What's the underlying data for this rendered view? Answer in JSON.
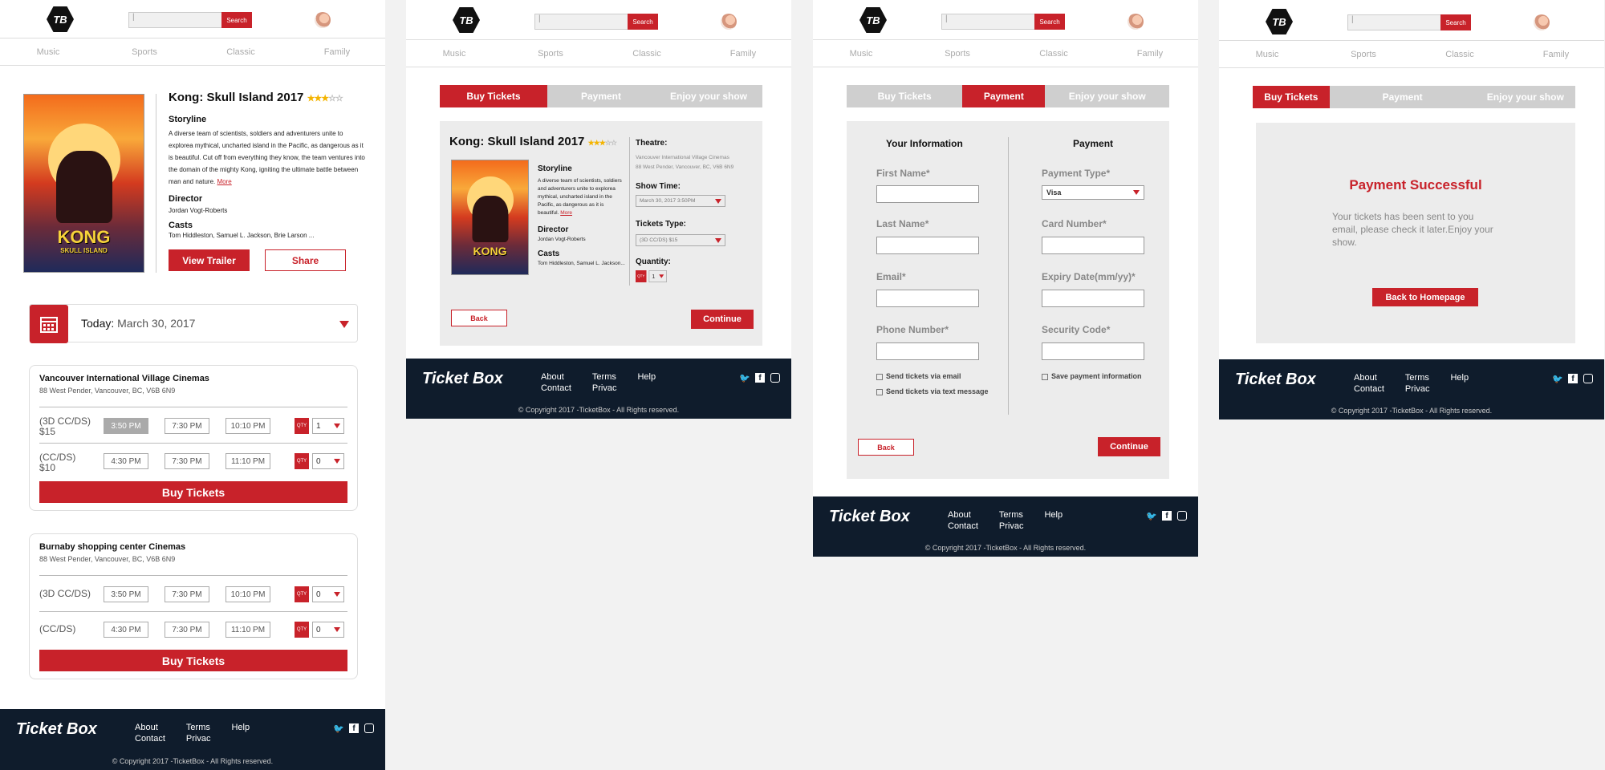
{
  "common": {
    "logo_text": "TB",
    "search_label": "Search",
    "nav": [
      "Music",
      "Sports",
      "Classic",
      "Family"
    ],
    "footer": {
      "brand": "Ticket Box",
      "about": "About",
      "contact": "Contact",
      "terms": "Terms",
      "privacy": "Privac",
      "help": "Help",
      "copyright": "© Copyright 2017 -TicketBox - All Rights reserved.",
      "social_icons": [
        "twitter-icon",
        "facebook-icon",
        "instagram-icon"
      ]
    },
    "accent_color": "#c8222a",
    "footer_color": "#0f1c2c"
  },
  "movie": {
    "title": "Kong: Skull Island 2017",
    "rating": 3,
    "rating_max": 5,
    "poster_title": "KONG",
    "poster_subtitle": "SKULL ISLAND",
    "storyline_label": "Storyline",
    "storyline": "A diverse team of scientists, soldiers and adventurers unite to explorea mythical, uncharted island in the Pacific, as dangerous as it is beautiful. Cut off from everything they know, the team ventures into the domain of the mighty Kong, igniting the ultimate battle between man and nature.",
    "storyline_short": "A diverse team of scientists, soldiers and adventurers unite to explorea mythical, uncharted island in the Pacific, as dangerous as it is beautiful.",
    "more": "More",
    "director_label": "Director",
    "director": "Jordan Vogt-Roberts",
    "casts_label": "Casts",
    "casts": "Tom Hiddleston, Samuel L. Jackson, Brie Larson ...",
    "casts_short": "Tom Hiddleston, Samuel L. Jackson...",
    "view_trailer": "View Trailer",
    "share": "Share"
  },
  "date_bar": {
    "prefix": "Today:",
    "date": "March 30, 2017"
  },
  "theatres": [
    {
      "name": "Vancouver International Village Cinemas",
      "address": "88 West Pender, Vancouver, BC, V6B 6N9",
      "rows": [
        {
          "type": "(3D CC/DS)\n$15",
          "times": [
            "3:50 PM",
            "7:30 PM",
            "10:10 PM"
          ],
          "qty": "1"
        },
        {
          "type": "(CC/DS)\n$10",
          "times": [
            "4:30 PM",
            "7:30 PM",
            "11:10 PM"
          ],
          "qty": "0"
        }
      ],
      "buy": "Buy Tickets"
    },
    {
      "name": "Burnaby shopping center Cinemas",
      "address": "88 West Pender, Vancouver, BC, V6B 6N9",
      "rows": [
        {
          "type": "(3D CC/DS)",
          "times": [
            "3:50 PM",
            "7:30 PM",
            "10:10 PM"
          ],
          "qty": "0"
        },
        {
          "type": "(CC/DS)",
          "times": [
            "4:30 PM",
            "7:30 PM",
            "11:10 PM"
          ],
          "qty": "0"
        }
      ],
      "buy": "Buy Tickets"
    }
  ],
  "qty_label": "QTY",
  "steps": [
    "Buy Tickets",
    "Payment",
    "Enjoy your show"
  ],
  "checkout": {
    "theatre_label": "Theatre:",
    "theatre": "Vancouver International Village Cinemas",
    "address": "88 West Pender, Vancouver, BC, V6B 6N9",
    "showtime_label": "Show Time:",
    "showtime": "March 30, 2017  3:50PM",
    "type_label": "Tickets Type:",
    "type": "(3D CC/DS)  $15",
    "quantity_label": "Quantity:",
    "quantity": "1",
    "back": "Back",
    "continue": "Continue"
  },
  "payment": {
    "info_heading": "Your Information",
    "pay_heading": "Payment",
    "first_name": "First Name*",
    "last_name": "Last Name*",
    "email": "Email*",
    "phone": "Phone Number*",
    "send_email": "Send tickets via email",
    "send_text": "Send tickets via text message",
    "payment_type": "Payment Type*",
    "payment_type_value": "Visa",
    "card_number": "Card Number*",
    "expiry": "Expiry Date(mm/yy)*",
    "security": "Security Code*",
    "save_payment": "Save payment information",
    "back": "Back",
    "continue": "Continue"
  },
  "success": {
    "title": "Payment Successful",
    "message": "Your tickets has been sent to you email, please check it later.Enjoy your show.",
    "button": "Back to Homepage"
  }
}
